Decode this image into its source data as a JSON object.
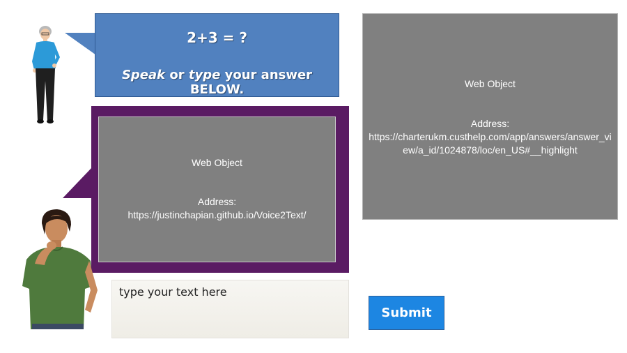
{
  "question": {
    "equation": "2+3 = ?",
    "instruction_parts": [
      "Speak",
      " or ",
      "type",
      " your answer BELOW."
    ]
  },
  "web_object_left": {
    "title": "Web Object",
    "address_label": "Address:",
    "address": "https://justinchapian.github.io/Voice2Text/"
  },
  "web_object_right": {
    "title": "Web Object",
    "address_label": "Address:",
    "address": "https://charterukm.custhelp.com/app/answers/answer_view/a_id/1024878/loc/en_US#__highlight"
  },
  "answer_input": {
    "placeholder": "type your text here",
    "value": ""
  },
  "submit": {
    "label": "Submit"
  },
  "colors": {
    "bubble": "#5181bf",
    "frame": "#5a1b63",
    "web_object": "#808080",
    "submit": "#1d86e2"
  }
}
